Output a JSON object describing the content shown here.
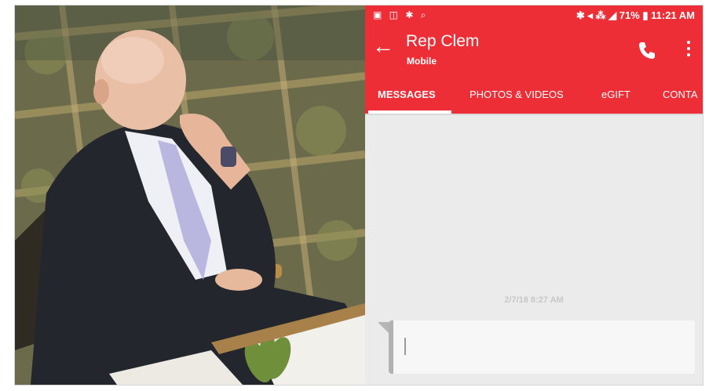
{
  "status_bar": {
    "left_icons": "▣ ◫ ✱ ⌕",
    "right_text": "✱ ◂ ⁂ ◢ 71% ▮ 11:21 AM"
  },
  "app_bar": {
    "title": "Rep Clem",
    "subtitle": "Mobile",
    "back_icon": "←"
  },
  "tabs": [
    {
      "label": "MESSAGES",
      "active": true
    },
    {
      "label": "PHOTOS & VIDEOS",
      "active": false
    },
    {
      "label": "eGIFT",
      "active": false
    },
    {
      "label": "CONTA",
      "active": false
    }
  ],
  "conversation": {
    "timestamp": "2/7/18 8:27 AM",
    "message_text": ""
  },
  "colors": {
    "accent": "#ee2e36",
    "conversation_bg": "#ebebeb",
    "bubble_bg": "#f7f7f7"
  },
  "icons": {
    "back": "back-arrow-icon",
    "call": "phone-call-icon",
    "more": "more-vertical-icon"
  }
}
